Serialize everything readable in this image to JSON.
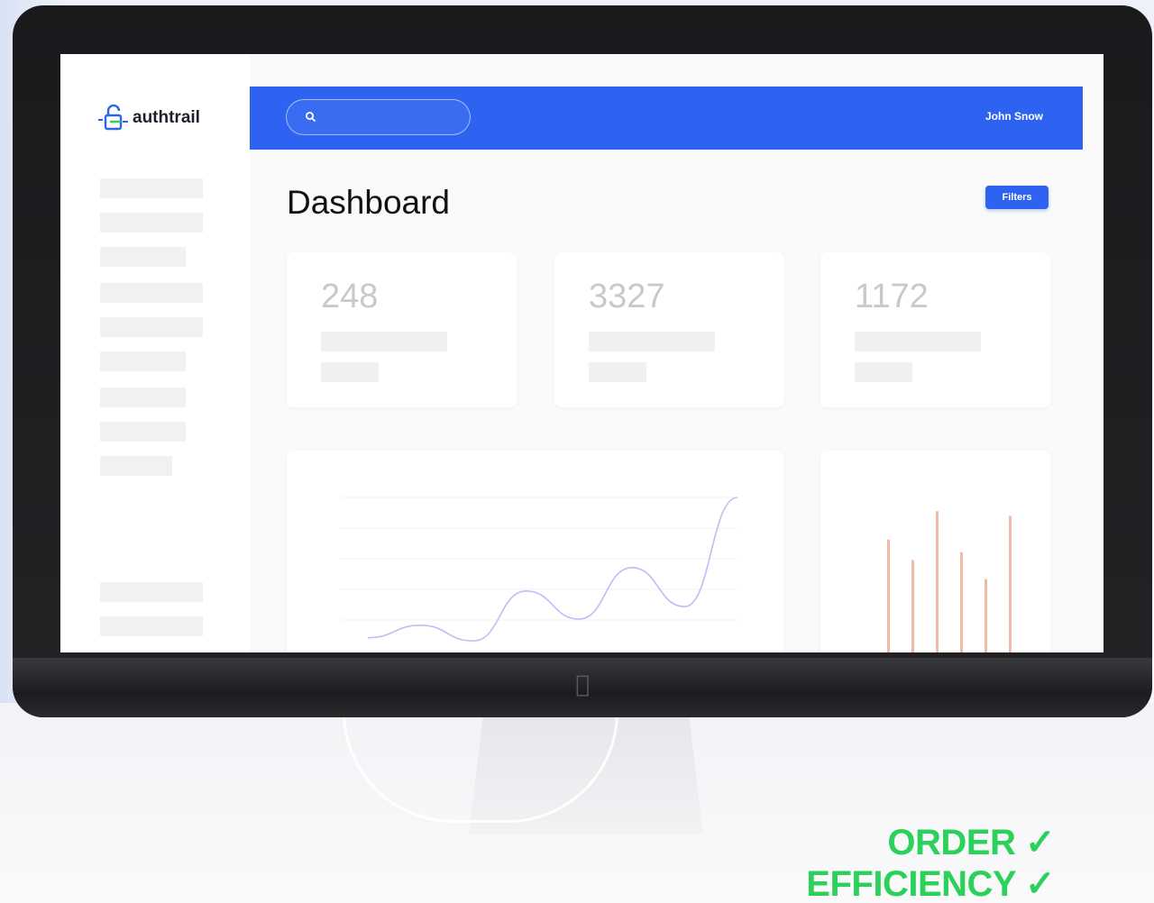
{
  "app": {
    "brand_name": "authtrail"
  },
  "header": {
    "search_placeholder": "",
    "user_name": "John Snow"
  },
  "main": {
    "title": "Dashboard",
    "filters_label": "Filters",
    "stats": [
      {
        "value": "248"
      },
      {
        "value": "3327"
      },
      {
        "value": "1172"
      }
    ]
  },
  "chart_data": [
    {
      "type": "line",
      "series": [
        {
          "values": [
            10,
            18,
            8,
            40,
            22,
            55,
            30,
            100
          ]
        }
      ],
      "color": "#b9bff7"
    },
    {
      "type": "bar",
      "values": [
        75,
        62,
        93,
        67,
        50,
        90
      ],
      "color": "#f2b9a6"
    }
  ],
  "overlay": {
    "line1": "ORDER ✓",
    "line2": "EFFICIENCY ✓"
  },
  "colors": {
    "accent": "#2d63f0",
    "tagline": "#2bd15a"
  },
  "icons": {
    "logo": "lock-icon",
    "search": "search-icon",
    "apple": "apple-logo-icon"
  }
}
